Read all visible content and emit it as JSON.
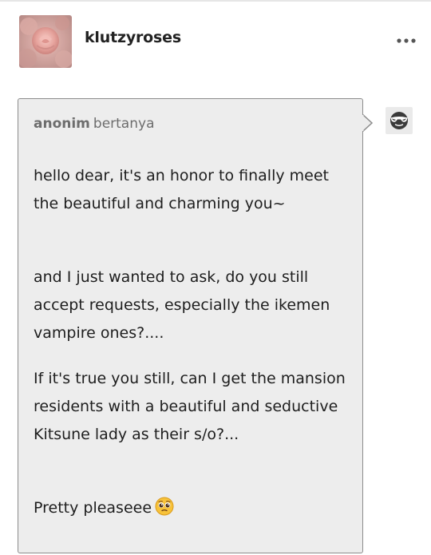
{
  "post": {
    "username": "klutzyroses",
    "more_icon": "ellipsis-icon"
  },
  "ask": {
    "asker_name": "anonim",
    "asker_verb": "bertanya",
    "paragraphs": [
      "hello dear, it's an honor to finally meet the beautiful and charming you~",
      "and I just wanted to ask, do you still accept requests, especially the ikemen vampire ones?....",
      "If it's true you still, can I get the mansion residents with a beautiful and seductive Kitsune lady as their s/o?...",
      "Pretty pleaseee"
    ],
    "emoji": "pleading-face-emoji",
    "anon_icon": "anonymous-sunglasses-icon"
  },
  "colors": {
    "box_background": "#ededed",
    "box_border": "#8c8c8c",
    "muted_text": "#6d6d6d",
    "body_text": "#1e1e1e"
  }
}
